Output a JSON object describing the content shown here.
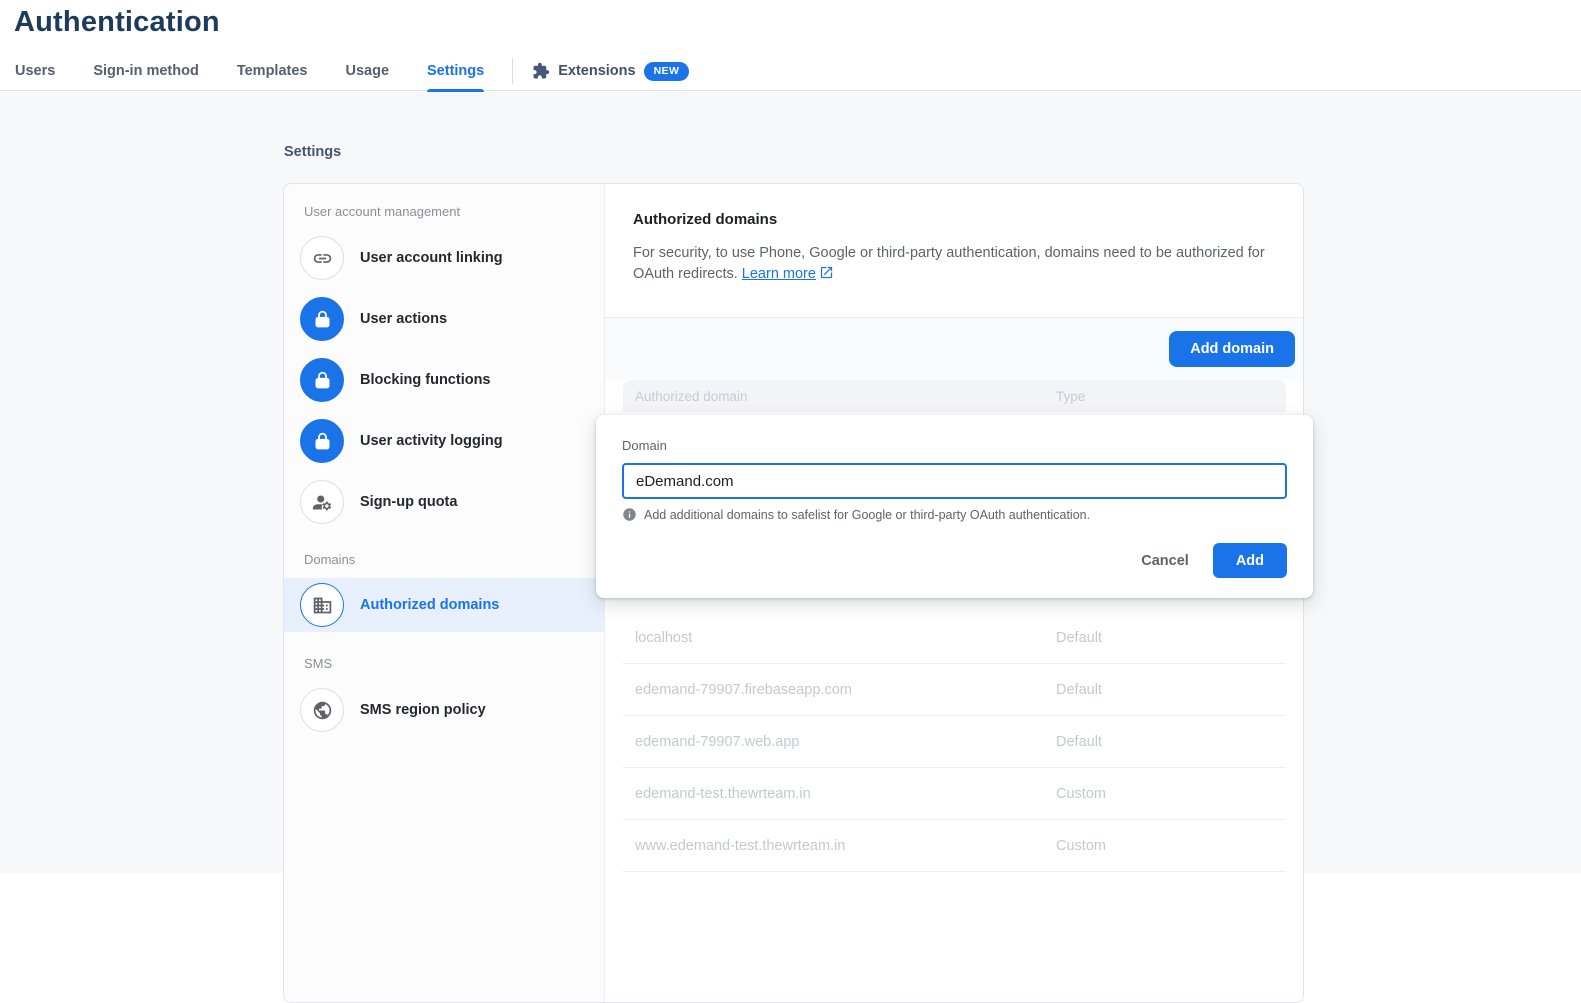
{
  "page": {
    "title": "Authentication"
  },
  "tabs": {
    "items": [
      {
        "label": "Users"
      },
      {
        "label": "Sign-in method"
      },
      {
        "label": "Templates"
      },
      {
        "label": "Usage"
      },
      {
        "label": "Settings"
      }
    ],
    "active": "Settings",
    "extensions": {
      "label": "Extensions",
      "badge": "NEW"
    }
  },
  "sidebar": {
    "title": "Settings",
    "sections": [
      {
        "header": "User account management",
        "items": [
          {
            "label": "User account linking",
            "icon": "link-icon"
          },
          {
            "label": "User actions",
            "icon": "lock-icon"
          },
          {
            "label": "Blocking functions",
            "icon": "lock-icon"
          },
          {
            "label": "User activity logging",
            "icon": "lock-icon"
          },
          {
            "label": "Sign-up quota",
            "icon": "manage-accounts-icon"
          }
        ]
      },
      {
        "header": "Domains",
        "items": [
          {
            "label": "Authorized domains",
            "icon": "domain-icon",
            "selected": true
          }
        ]
      },
      {
        "header": "SMS",
        "items": [
          {
            "label": "SMS region policy",
            "icon": "globe-icon"
          }
        ]
      }
    ]
  },
  "panel": {
    "heading": "Authorized domains",
    "description": "For security, to use Phone, Google or third-party authentication, domains need to be authorized for OAuth redirects.",
    "learn_more_label": "Learn more",
    "add_domain_label": "Add domain",
    "table": {
      "columns": [
        "Authorized domain",
        "Type"
      ],
      "rows": [
        {
          "domain": "localhost",
          "type": "Default"
        },
        {
          "domain": "edemand-79907.firebaseapp.com",
          "type": "Default"
        },
        {
          "domain": "edemand-79907.web.app",
          "type": "Default"
        },
        {
          "domain": "edemand-test.thewrteam.in",
          "type": "Custom"
        },
        {
          "domain": "www.edemand-test.thewrteam.in",
          "type": "Custom"
        }
      ]
    }
  },
  "dialog": {
    "field_label": "Domain",
    "field_value": "eDemand.com",
    "helper_text": "Add additional domains to safelist for Google or third-party OAuth authentication.",
    "cancel_label": "Cancel",
    "add_label": "Add"
  },
  "colors": {
    "accent": "#1a73e8",
    "selected_item_bg": "#e8f0fe",
    "title_text": "#1c3b5d",
    "muted_text": "#5f6368",
    "dimmed_table_text": "#c5c9cf"
  }
}
